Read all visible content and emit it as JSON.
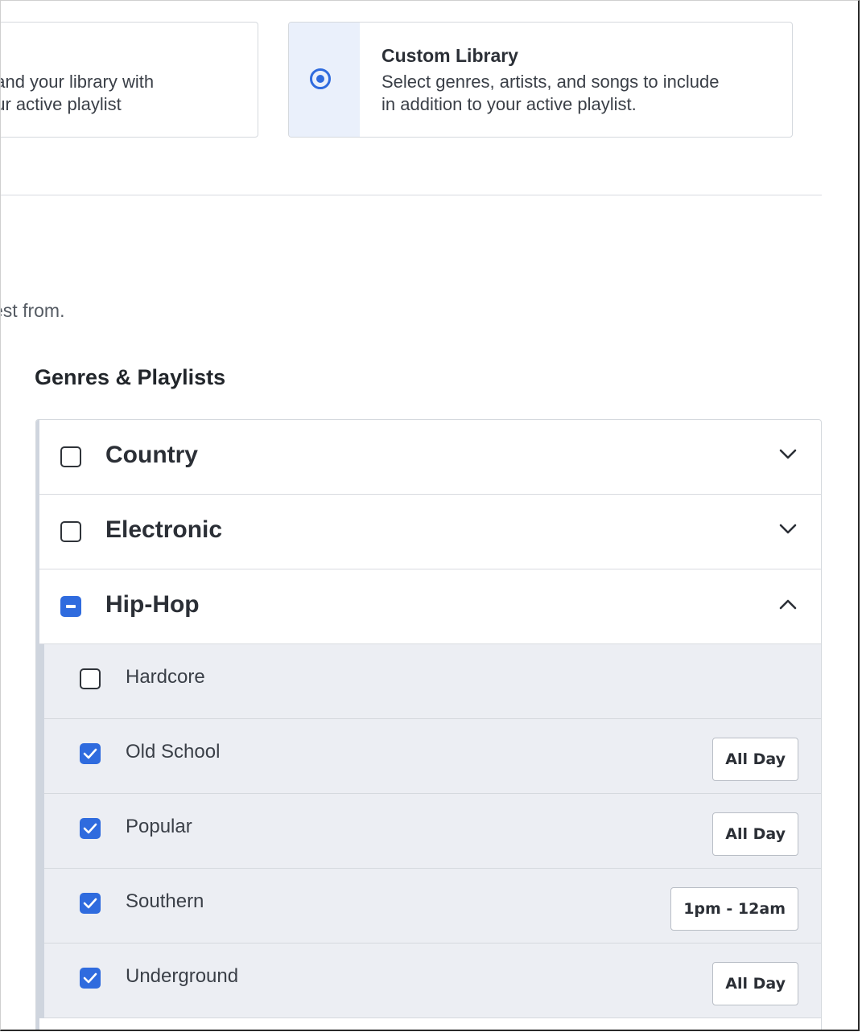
{
  "library_options": {
    "left_card": {
      "desc_line1": "pand your library with",
      "desc_line2": "our active playlist"
    },
    "right_card": {
      "title": "Custom Library",
      "desc_line1": "Select genres, artists, and songs to include",
      "desc_line2": "in addition to your active playlist.",
      "selected": true
    }
  },
  "hint_text": "est from.",
  "section_title": "Genres & Playlists",
  "genres": [
    {
      "label": "Country",
      "state": "unchecked",
      "expanded": false,
      "icon": "chevron-down-icon"
    },
    {
      "label": "Electronic",
      "state": "unchecked",
      "expanded": false,
      "icon": "chevron-down-icon"
    },
    {
      "label": "Hip-Hop",
      "state": "partial",
      "expanded": true,
      "icon": "chevron-up-icon"
    }
  ],
  "hiphop_subgenres": [
    {
      "label": "Hardcore",
      "checked": false,
      "schedule": ""
    },
    {
      "label": "Old School",
      "checked": true,
      "schedule": "All Day"
    },
    {
      "label": "Popular",
      "checked": true,
      "schedule": "All Day"
    },
    {
      "label": "Southern",
      "checked": true,
      "schedule": "1pm - 12am"
    },
    {
      "label": "Underground",
      "checked": true,
      "schedule": "All Day"
    }
  ],
  "colors": {
    "accent": "#2f6bde",
    "selected_card_bg": "#eaf0fb",
    "subgenre_bg": "#eceef3"
  }
}
